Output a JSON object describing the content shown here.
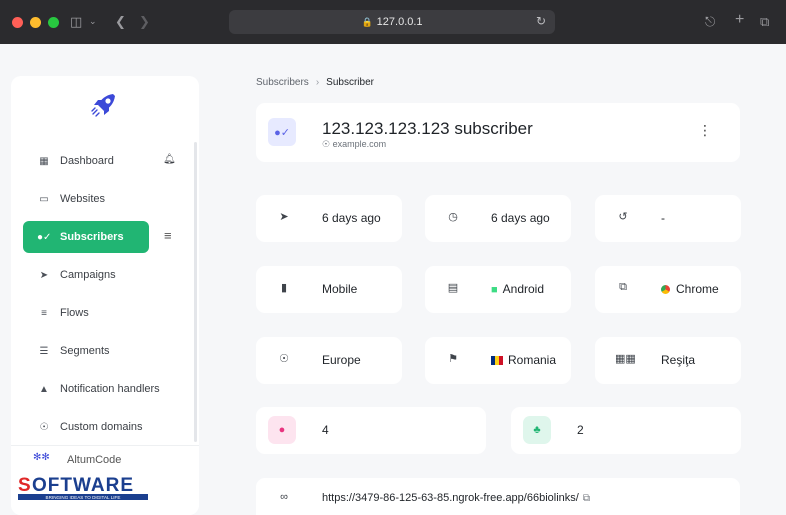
{
  "browser": {
    "url": "127.0.0.1",
    "lights": [
      "#ff5f57",
      "#febc2e",
      "#28c840"
    ]
  },
  "sidebar": {
    "items": [
      {
        "label": "Dashboard",
        "icon": "dashboard-icon"
      },
      {
        "label": "Websites",
        "icon": "websites-icon"
      },
      {
        "label": "Subscribers",
        "icon": "subscribers-icon",
        "active": true
      },
      {
        "label": "Campaigns",
        "icon": "campaigns-icon"
      },
      {
        "label": "Flows",
        "icon": "flows-icon"
      },
      {
        "label": "Segments",
        "icon": "segments-icon"
      },
      {
        "label": "Notification handlers",
        "icon": "bell-icon"
      },
      {
        "label": "Custom domains",
        "icon": "globe-icon"
      }
    ],
    "brand": "AltumCode",
    "accent": "#21b573"
  },
  "watermark": "SOFTWARE",
  "watermark_tagline": "BRINGING IDEAS TO DIGITAL LIFE",
  "breadcrumb": {
    "parent": "Subscribers",
    "current": "Subscriber"
  },
  "subscriber": {
    "title": "123.123.123.123 subscriber",
    "site": "example.com"
  },
  "stats": {
    "subscribed": "6 days ago",
    "last_activity": "6 days ago",
    "last_sent": "-",
    "device": "Mobile",
    "os": "Android",
    "browser": "Chrome",
    "continent": "Europe",
    "country": "Romania",
    "city": "Reşiţa",
    "sent_count": "4",
    "displayed_count": "2",
    "url": "https://3479-86-125-63-85.ngrok-free.app/66biolinks/"
  }
}
